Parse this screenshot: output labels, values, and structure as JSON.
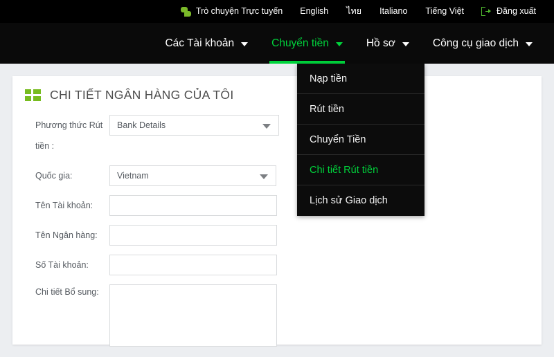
{
  "topbar": {
    "chat_icon": "chat-bubbles-icon",
    "chat_label": "Trò chuyện Trực tuyến",
    "languages": [
      "English",
      "ไทย",
      "Italiano",
      "Tiếng Việt"
    ],
    "logout_icon": "logout-icon",
    "logout_label": "Đăng xuất"
  },
  "mainnav": {
    "items": [
      {
        "label": "Các Tài khoản",
        "active": false,
        "caret": "chevron-down-icon"
      },
      {
        "label": "Chuyển tiền",
        "active": true,
        "caret": "chevron-down-icon"
      },
      {
        "label": "Hồ sơ",
        "active": false,
        "caret": "chevron-down-icon"
      },
      {
        "label": "Công cụ giao dịch",
        "active": false,
        "caret": "chevron-down-icon"
      }
    ],
    "accent_color": "#00d43c",
    "bar_color": "#0a0a0a"
  },
  "dropdown": {
    "items": [
      {
        "label": "Nạp tiền",
        "active": false
      },
      {
        "label": "Rút tiền",
        "active": false
      },
      {
        "label": "Chuyển Tiền",
        "active": false
      },
      {
        "label": "Chi tiết Rút tiền",
        "active": true
      },
      {
        "label": "Lịch sử Giao dịch",
        "active": false
      }
    ]
  },
  "card": {
    "title_icon": "grid-list-icon",
    "title": "CHI TIẾT NGÂN HÀNG CỦA TÔI",
    "title_color": "#4c4c4c",
    "icon_color": "#77bc1f",
    "form": {
      "rows": [
        {
          "label": "Phương thức Rút tiền :",
          "type": "select",
          "value": "Bank Details",
          "options": [
            "Bank Details"
          ]
        },
        {
          "label": "Quốc gia:",
          "type": "select",
          "value": "Vietnam",
          "options": [
            "Vietnam"
          ]
        },
        {
          "label": "Tên Tài khoản:",
          "type": "text",
          "value": "",
          "placeholder": ""
        },
        {
          "label": "Tên Ngân hàng:",
          "type": "text",
          "value": "",
          "placeholder": ""
        },
        {
          "label": "Số Tài khoản:",
          "type": "text",
          "value": "",
          "placeholder": ""
        },
        {
          "label": "Chi tiết Bổ sung:",
          "type": "textarea",
          "value": "",
          "placeholder": ""
        }
      ]
    }
  }
}
